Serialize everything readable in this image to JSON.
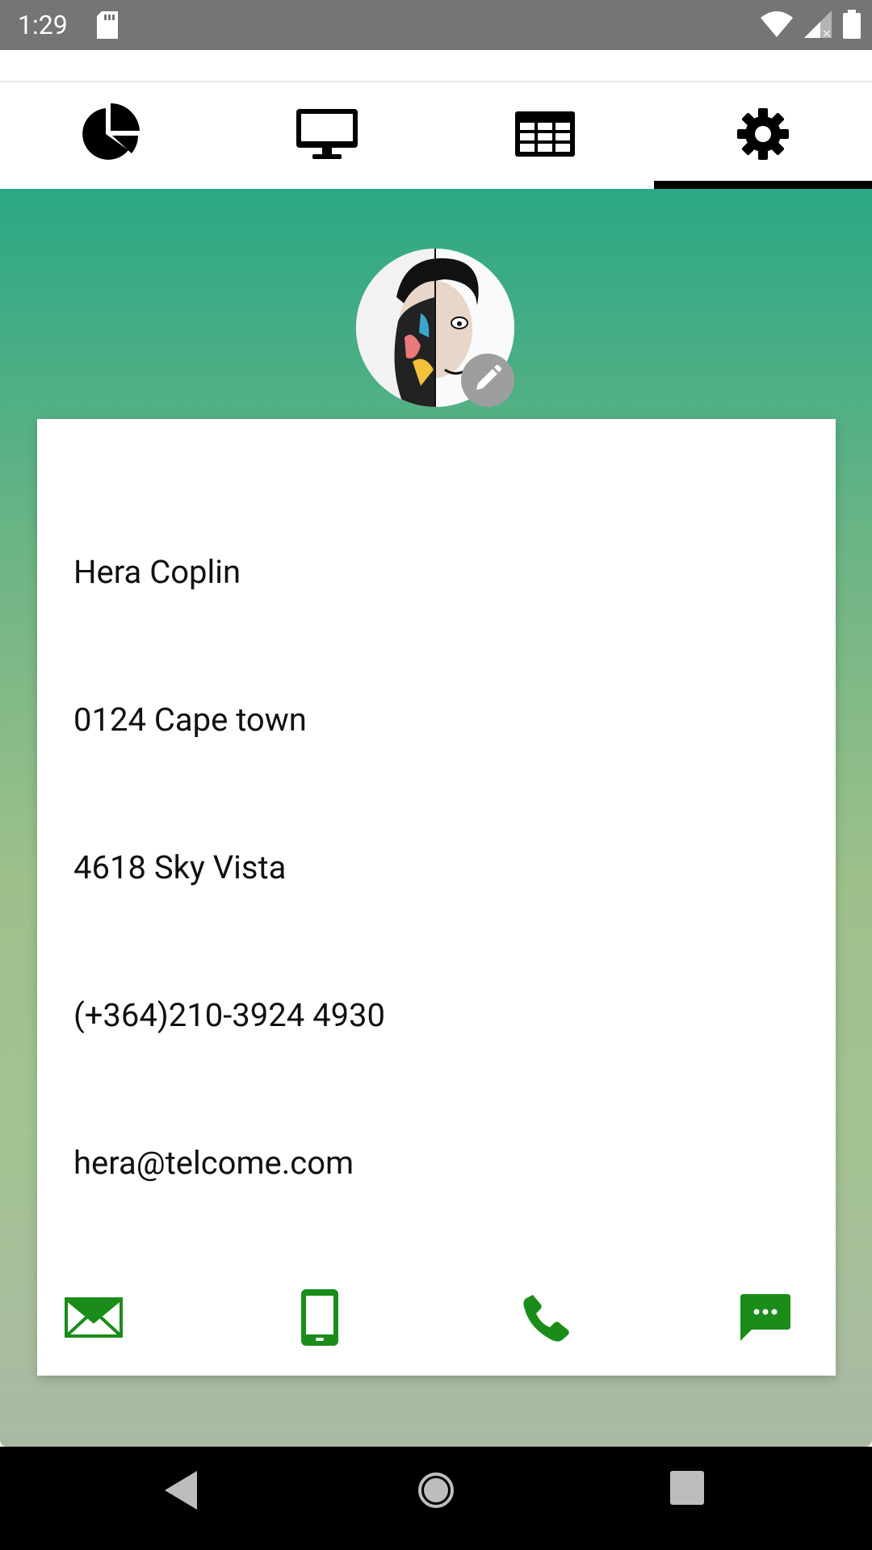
{
  "status_bar": {
    "time": "1:29",
    "icons": [
      "sd-card-icon",
      "wifi-icon",
      "signal-icon",
      "battery-icon"
    ]
  },
  "tabs": [
    {
      "name": "pie-chart-icon",
      "active": false
    },
    {
      "name": "desktop-icon",
      "active": false
    },
    {
      "name": "table-icon",
      "active": false
    },
    {
      "name": "settings-gear-icon",
      "active": true
    }
  ],
  "profile": {
    "name": "Hera Coplin",
    "line2": "0124 Cape town",
    "address": "4618 Sky Vista",
    "phone": "(+364)210-3924 4930",
    "email": "hera@telcome.com"
  },
  "actions": [
    "email-icon",
    "mobile-phone-icon",
    "call-icon",
    "message-icon"
  ],
  "colors": {
    "accent_green": "#1a8c1a",
    "status_bar": "#757575",
    "gradient_top": "#2ba885",
    "gradient_bottom": "#aab9a4"
  }
}
